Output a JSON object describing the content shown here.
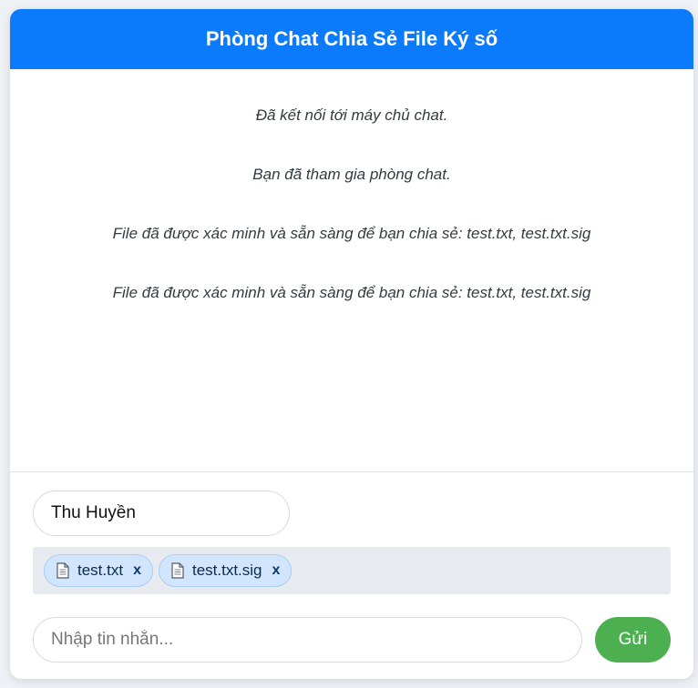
{
  "header": {
    "title": "Phòng Chat Chia Sẻ File Ký số"
  },
  "messages": [
    {
      "text": "Đã kết nối tới máy chủ chat."
    },
    {
      "text": "Bạn đã tham gia phòng chat."
    },
    {
      "text": "File đã được xác minh và sẵn sàng để bạn chia sẻ: test.txt, test.txt.sig"
    },
    {
      "text": "File đã được xác minh và sẵn sàng để bạn chia sẻ: test.txt, test.txt.sig"
    }
  ],
  "name_field": {
    "value": "Thu Huyền"
  },
  "attachments": [
    {
      "name": "test.txt",
      "icon": "document-icon",
      "remove_label": "x"
    },
    {
      "name": "test.txt.sig",
      "icon": "document-icon",
      "remove_label": "x"
    }
  ],
  "composer": {
    "placeholder": "Nhập tin nhắn...",
    "value": "",
    "send_label": "Gửi"
  },
  "colors": {
    "header": "#0b7bfb",
    "send_button": "#4caf50",
    "chip_background": "#d1e6fd"
  }
}
